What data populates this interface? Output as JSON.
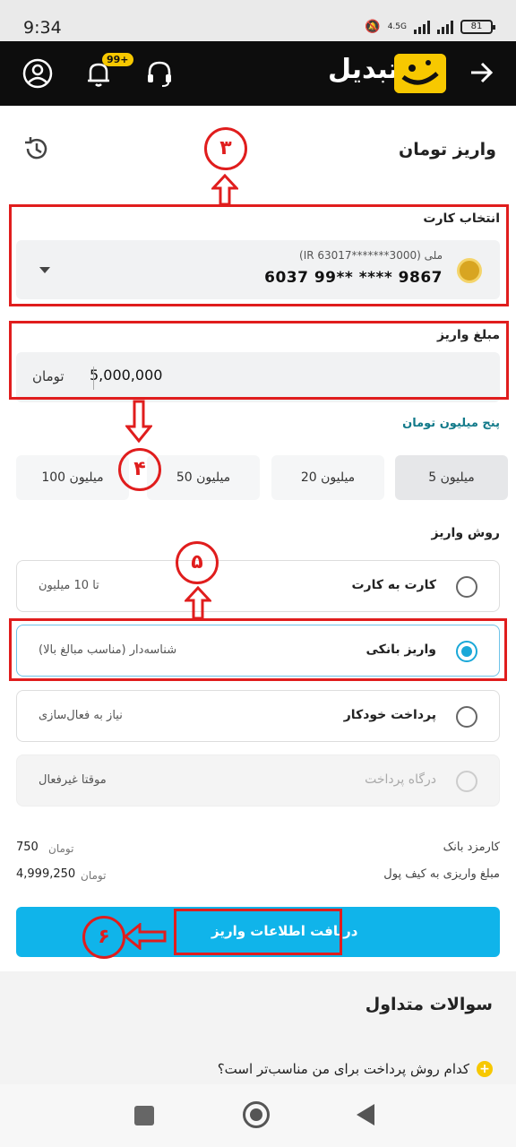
{
  "status": {
    "time": "9:34",
    "network": "4.5G",
    "battery": "81"
  },
  "header": {
    "brand": "تبدیل",
    "notifications_badge": "99+"
  },
  "page": {
    "title": "واریز تومان"
  },
  "card_section": {
    "label": "انتخاب کارت",
    "card_name": "ملی (IR 63017*******3000)",
    "card_number": "6037 99** **** 9867"
  },
  "amount_section": {
    "label": "مبلغ واریز",
    "value": "5,000,000",
    "unit": "تومان",
    "in_words": "پنج میلیون تومان"
  },
  "quick_amounts": [
    "5 میلیون",
    "20 میلیون",
    "50 میلیون",
    "100 میلیون"
  ],
  "method_section": {
    "label": "روش واریز",
    "methods": [
      {
        "title": "کارت به کارت",
        "desc": "تا 10 میلیون"
      },
      {
        "title": "واریز بانکی",
        "desc": "شناسه‌دار (مناسب مبالغ بالا)"
      },
      {
        "title": "پرداخت خودکار",
        "desc": "نیاز به فعال‌سازی"
      },
      {
        "title": "درگاه پرداخت",
        "desc": "موقتا غیرفعال"
      }
    ]
  },
  "fees": {
    "bank_fee_label": "کارمزد بانک",
    "bank_fee_value": "750",
    "bank_fee_unit": "تومان",
    "deposit_label": "مبلغ واریزی به کیف پول",
    "deposit_value": "4,999,250",
    "deposit_unit": "تومان"
  },
  "submit": {
    "label": "دریافت اطلاعات واریز"
  },
  "faq": {
    "title": "سوالات متداول",
    "first_question": "کدام روش پرداخت برای من مناسب‌تر است؟"
  },
  "annotations": [
    "۳",
    "۴",
    "۵",
    "۶"
  ],
  "colors": {
    "brand_yellow": "#f7c800",
    "accent_blue": "#10b4ea",
    "annotation_red": "#e01d1d"
  }
}
